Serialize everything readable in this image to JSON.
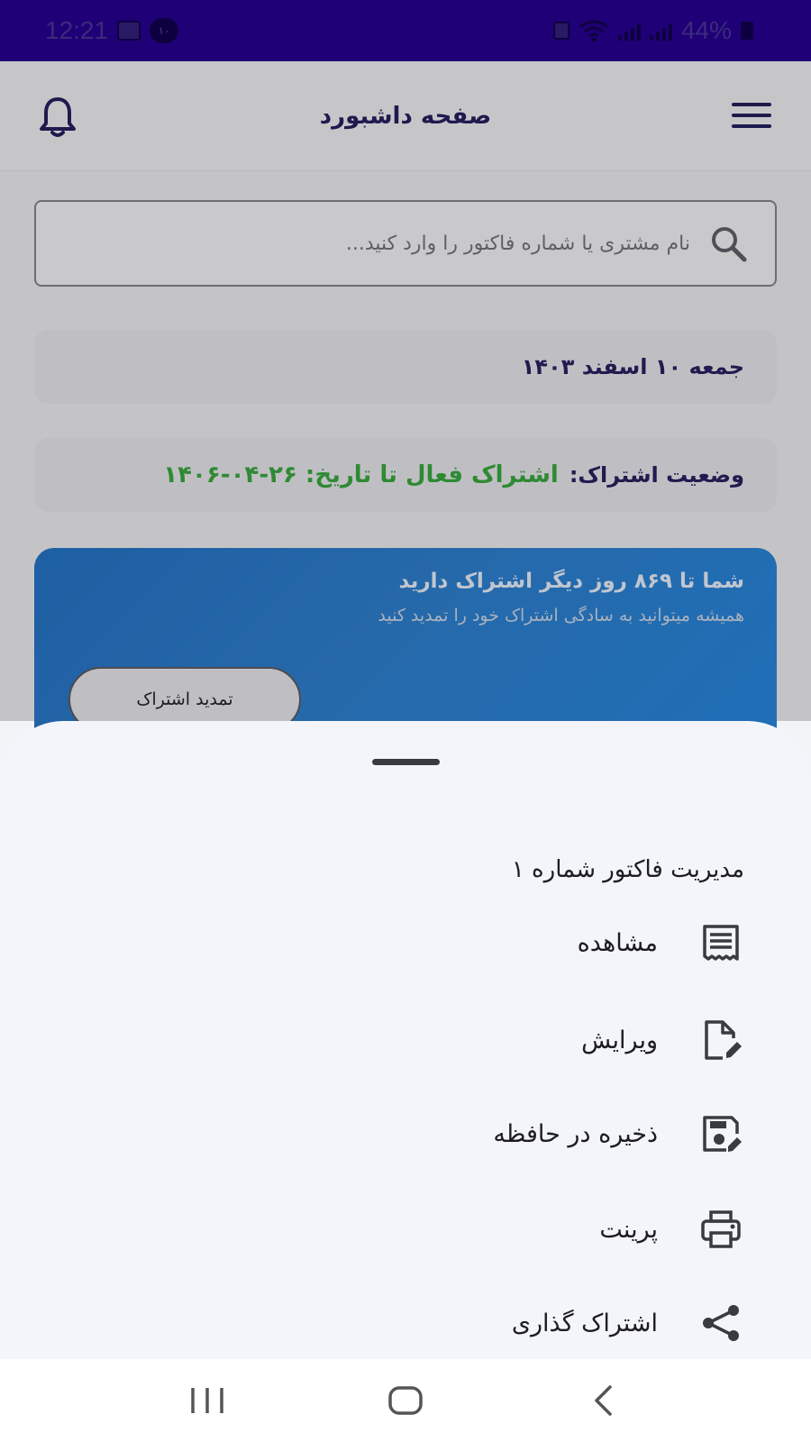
{
  "status_bar": {
    "time": "12:21",
    "notification_badge": "۱۰",
    "battery": "44%"
  },
  "app_bar": {
    "title": "صفحه داشبورد",
    "icons": {
      "menu": "hamburger-icon",
      "notifications": "bell-icon"
    }
  },
  "search": {
    "placeholder": "نام مشتری یا شماره فاکتور را وارد کنید...",
    "value": "",
    "icon": "search-icon"
  },
  "date_card": {
    "text": "جمعه ۱۰ اسفند ۱۴۰۳"
  },
  "subscription_card": {
    "label": "وضعیت اشتراک:",
    "value": "اشتراک فعال تا تاریخ: ۲۶-۰۴-۱۴۰۶",
    "value_color": "#2f8a33"
  },
  "promo": {
    "title": "شما تا ۸۶۹ روز دیگر اشتراک دارید",
    "subtitle": "همیشه میتوانید به سادگی اشتراک خود را تمدید کنید",
    "button_label": "تمدید اشتراک",
    "background": "#2669aa"
  },
  "sheet": {
    "title": "مدیریت فاکتور شماره ۱",
    "actions": [
      {
        "label": "مشاهده",
        "icon": "receipt-icon"
      },
      {
        "label": "ویرایش",
        "icon": "edit-file-icon"
      },
      {
        "label": "ذخیره در حافظه",
        "icon": "save-icon"
      },
      {
        "label": "پرینت",
        "icon": "printer-icon"
      },
      {
        "label": "اشتراک گذاری",
        "icon": "share-icon"
      }
    ]
  },
  "nav_bar": {
    "icons": [
      "recent-apps-icon",
      "home-icon",
      "back-icon"
    ]
  },
  "colors": {
    "status_bar": "#1f0076",
    "primary_text": "#1f1a4e",
    "sheet_bg": "#f4f5fb"
  }
}
